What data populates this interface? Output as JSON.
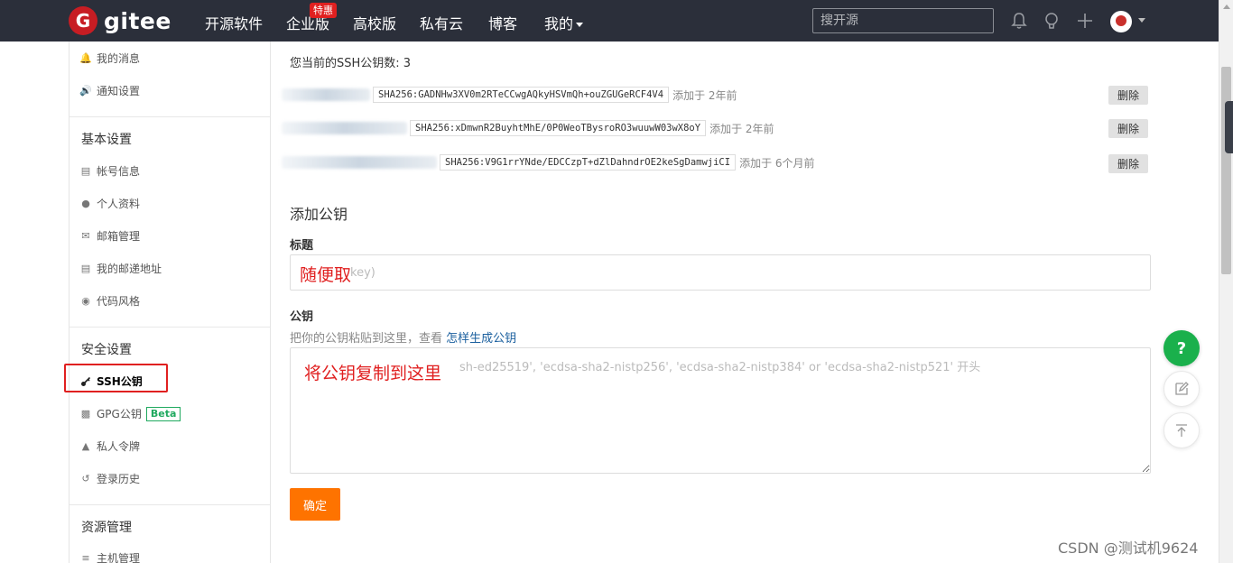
{
  "topnav": {
    "logo_letter": "G",
    "logo_text": "gitee",
    "items": [
      "开源软件",
      "企业版",
      "高校版",
      "私有云",
      "博客",
      "我的"
    ],
    "hot_badge": "特惠",
    "search_placeholder": "搜开源"
  },
  "sidebar": {
    "items_top": [
      {
        "label": "我的消息",
        "icon": "bell-icon"
      },
      {
        "label": "通知设置",
        "icon": "speaker-icon"
      }
    ],
    "section_basic": "基本设置",
    "basic_items": [
      {
        "label": "帐号信息",
        "icon": "id-card-icon"
      },
      {
        "label": "个人资料",
        "icon": "user-icon"
      },
      {
        "label": "邮箱管理",
        "icon": "mail-icon"
      },
      {
        "label": "我的邮递地址",
        "icon": "address-card-icon"
      },
      {
        "label": "代码风格",
        "icon": "palette-icon"
      }
    ],
    "section_security": "安全设置",
    "security_items": [
      {
        "label": "SSH公钥",
        "icon": "key-icon",
        "active": true
      },
      {
        "label": "GPG公钥",
        "icon": "lock-icon",
        "badge": "Beta"
      },
      {
        "label": "私人令牌",
        "icon": "token-icon"
      },
      {
        "label": "登录历史",
        "icon": "history-icon"
      }
    ],
    "section_resource": "资源管理",
    "resource_items": [
      {
        "label": "主机管理",
        "icon": "server-icon"
      }
    ]
  },
  "main": {
    "key_count": "您当前的SSH公钥数: 3",
    "keys": [
      {
        "fingerprint": "SHA256:GADNHw3XV0m2RTeCCwgAQkyHSVmQh+ouZGUGeRCF4V4",
        "added": "添加于 2年前",
        "delete_label": "删除"
      },
      {
        "fingerprint": "SHA256:xDmwnR2BuyhtMhE/0P0WeoTBysroRO3wuuwW03wX8oY",
        "added": "添加于 2年前",
        "delete_label": "删除"
      },
      {
        "fingerprint": "SHA256:V9G1rrYNde/EDCCzpT+dZlDahndrOE2keSgDamwjiCI",
        "added": "添加于 6个月前",
        "delete_label": "删除"
      }
    ],
    "add_title": "添加公钥",
    "title_label": "标题",
    "title_placeholder": "key)",
    "pubkey_label": "公钥",
    "hint_text": "把你的公钥粘贴到这里，查看 ",
    "hint_link": "怎样生成公钥",
    "pubkey_placeholder": "sh-ed25519', 'ecdsa-sha2-nistp256', 'ecdsa-sha2-nistp384' or 'ecdsa-sha2-nistp521' 开头",
    "annot_title": "随便取",
    "annot_key": "将公钥复制到这里",
    "submit_label": "确定"
  },
  "floating": {
    "help": "?"
  },
  "watermark": "CSDN @测试机9624",
  "colors": {
    "nav_bg": "#2b2f3a",
    "brand_red": "#c71d23",
    "submit_orange": "#fe7300",
    "help_green": "#1ab04c",
    "annotation_red": "#e02020"
  }
}
